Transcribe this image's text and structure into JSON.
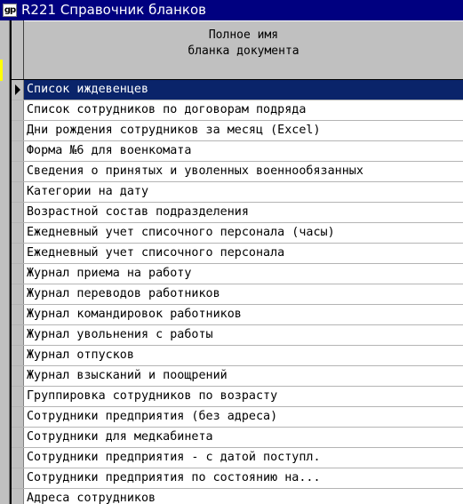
{
  "window": {
    "icon_label": "gp",
    "title": "R221 Справочник бланков"
  },
  "grid": {
    "header": {
      "line1": "Полное имя",
      "line2": "бланка документа"
    },
    "selected_index": 0,
    "rows": [
      "Список иждевенцев",
      "Список сотрудников по договорам подряда",
      "Дни рождения сотрудников за месяц (Excel)",
      "Форма №6 для военкомата",
      "Сведения о принятых и уволенных военнообязанных",
      "Категории на дату",
      "Возрастной состав подразделения",
      "Ежедневный учет списочного персонала (часы)",
      "Ежедневный учет списочного персонала",
      "Журнал приема на работу",
      "Журнал переводов работников",
      "Журнал командировок работников",
      "Журнал увольнения с работы",
      "Журнал отпусков",
      "Журнал взысканий и поощрений",
      "Группировка сотрудников по возрасту",
      "Сотрудники предприятия (без адреса)",
      "Сотрудники для медкабинета",
      "Сотрудники предприятия - с датой поступл.",
      "Сотрудники предприятия по состоянию на...",
      "Адреса сотрудников"
    ]
  },
  "colors": {
    "titlebar": "#000080",
    "selection": "#0a246a",
    "face": "#c0c0c0"
  }
}
